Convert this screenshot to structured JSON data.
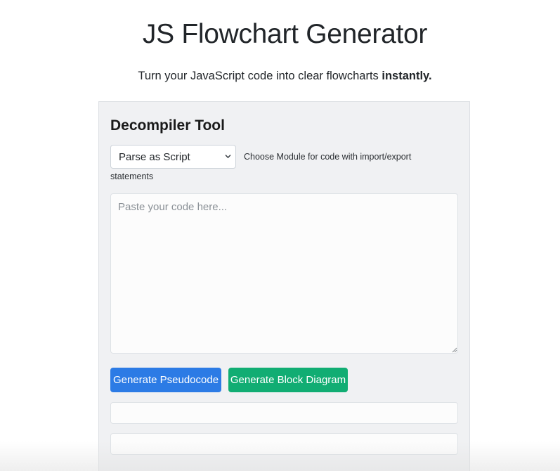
{
  "header": {
    "title": "JS Flowchart Generator",
    "subtitle_prefix": "Turn your JavaScript code into clear flowcharts ",
    "subtitle_emphasis": "instantly."
  },
  "tool": {
    "title": "Decompiler Tool",
    "mode_select": {
      "selected": "Parse as Script",
      "icon": "chevron-down-icon"
    },
    "help_text_line1": "Choose Module for code with import/export",
    "help_text_line2": "statements",
    "code_input": {
      "value": "",
      "placeholder": "Paste your code here..."
    },
    "buttons": {
      "pseudocode_label": "Generate Pseudocode",
      "diagram_label": "Generate Block Diagram"
    },
    "outputs": {
      "pseudocode_value": "",
      "diagram_value": ""
    }
  },
  "colors": {
    "primary": "#2c7be5",
    "success": "#11ad73",
    "card_background": "#f0f1f3"
  }
}
